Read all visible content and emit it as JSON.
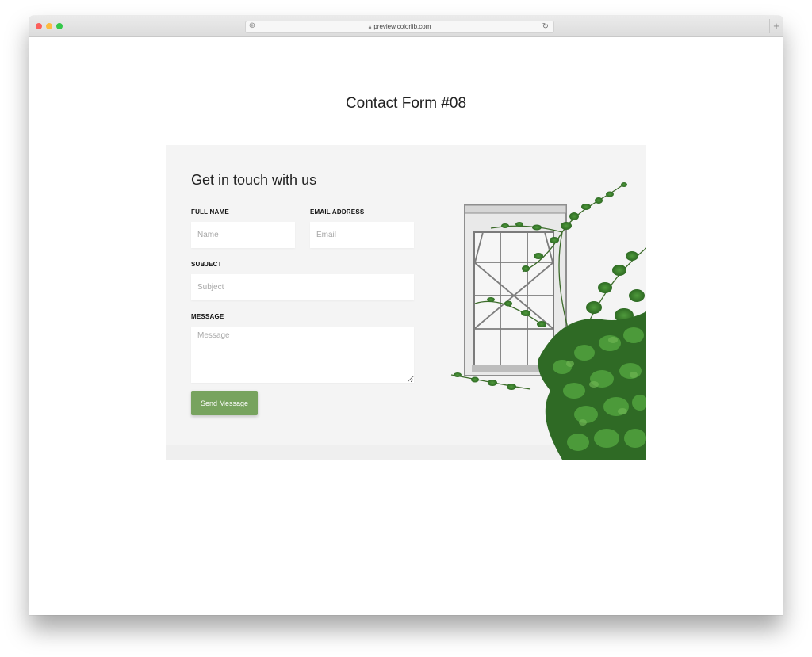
{
  "browser": {
    "url": "preview.colorlib.com"
  },
  "page": {
    "title": "Contact Form #08"
  },
  "form": {
    "heading": "Get in touch with us",
    "full_name_label": "FULL NAME",
    "full_name_placeholder": "Name",
    "email_label": "EMAIL ADDRESS",
    "email_placeholder": "Email",
    "subject_label": "SUBJECT",
    "subject_placeholder": "Subject",
    "message_label": "MESSAGE",
    "message_placeholder": "Message",
    "send_label": "Send Message"
  },
  "colors": {
    "accent": "#77a35e",
    "card_background": "#f4f4f4"
  }
}
